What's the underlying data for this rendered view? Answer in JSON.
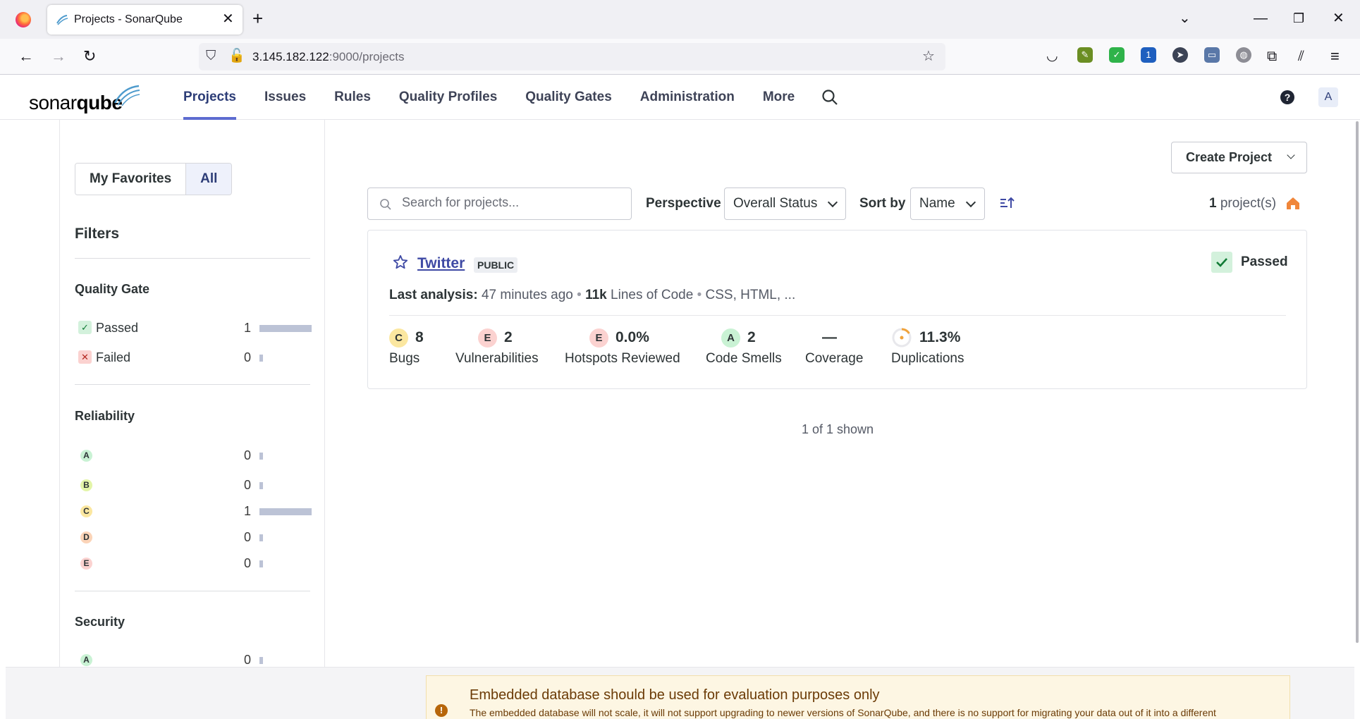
{
  "browser": {
    "tab_title": "Projects - SonarQube",
    "url_host": "3.145.182.122",
    "url_path": ":9000/projects"
  },
  "header": {
    "logo_light": "sonar",
    "logo_bold": "qube",
    "nav": [
      "Projects",
      "Issues",
      "Rules",
      "Quality Profiles",
      "Quality Gates",
      "Administration",
      "More"
    ],
    "active_nav": "Projects",
    "avatar_letter": "A",
    "help_glyph": "?"
  },
  "sidebar": {
    "favorites_label": "My Favorites",
    "all_label": "All",
    "filters_title": "Filters",
    "quality_gate": {
      "title": "Quality Gate",
      "items": [
        {
          "label": "Passed",
          "count": "1",
          "fraction": 1.0,
          "icon": "check-icon"
        },
        {
          "label": "Failed",
          "count": "0",
          "fraction": 0.0,
          "icon": "cross-icon"
        }
      ]
    },
    "reliability": {
      "title": "Reliability",
      "items": [
        {
          "rating": "A",
          "count": "0",
          "fraction": 0.0
        },
        {
          "rating": "B",
          "count": "0",
          "fraction": 0.0
        },
        {
          "rating": "C",
          "count": "1",
          "fraction": 1.0
        },
        {
          "rating": "D",
          "count": "0",
          "fraction": 0.0
        },
        {
          "rating": "E",
          "count": "0",
          "fraction": 0.0
        }
      ]
    },
    "security": {
      "title": "Security",
      "items": [
        {
          "rating": "A",
          "count": "0",
          "fraction": 0.0
        }
      ]
    }
  },
  "main": {
    "create_project": "Create Project",
    "search_placeholder": "Search for projects...",
    "perspective_label": "Perspective",
    "perspective_value": "Overall Status",
    "sortby_label": "Sort by",
    "sortby_value": "Name",
    "count_num": "1",
    "count_suffix": "project(s)",
    "shown": "1 of 1 shown",
    "project": {
      "name": "Twitter",
      "visibility": "PUBLIC",
      "quality_gate": "Passed",
      "last_analysis_label": "Last analysis:",
      "last_analysis_value": "47 minutes ago",
      "loc_value": "11k",
      "loc_label": "Lines of Code",
      "languages": "CSS, HTML, ...",
      "measures": [
        {
          "rating": "C",
          "value": "8",
          "name": "Bugs"
        },
        {
          "rating": "E",
          "value": "2",
          "name": "Vulnerabilities"
        },
        {
          "rating": "E",
          "value": "0.0%",
          "name": "Hotspots Reviewed"
        },
        {
          "rating": "A",
          "value": "2",
          "name": "Code Smells"
        },
        {
          "rating": "",
          "value": "—",
          "name": "Coverage"
        },
        {
          "rating": "",
          "value": "11.3%",
          "name": "Duplications"
        }
      ]
    }
  },
  "warning": {
    "title": "Embedded database should be used for evaluation purposes only",
    "text": "The embedded database will not scale, it will not support upgrading to newer versions of SonarQube, and there is no support for migrating your data out of it into a different"
  },
  "colors": {
    "rating_A": "#c9f2d4",
    "rating_B": "#e3f5a8",
    "rating_C": "#fbe7a0",
    "rating_D": "#fbd4b8",
    "rating_E": "#fbd2d0",
    "accent": "#5d6cd0",
    "link": "#3e49a4"
  }
}
